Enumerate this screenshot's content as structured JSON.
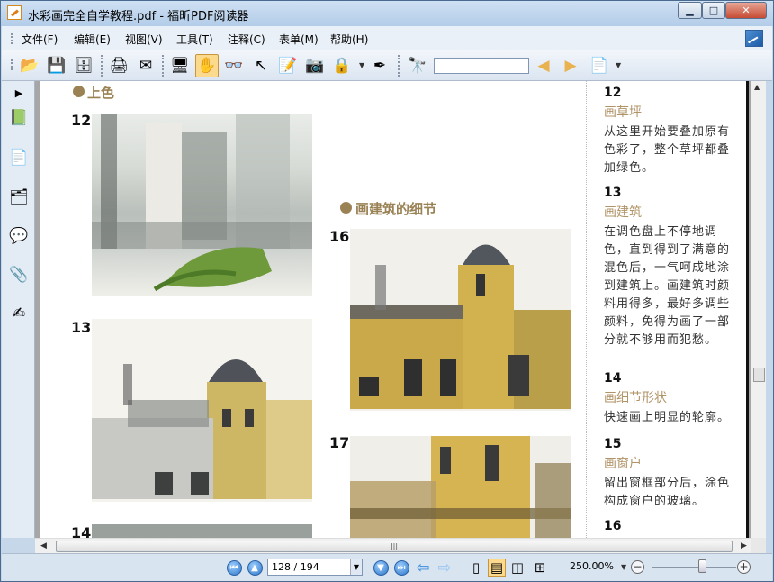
{
  "window": {
    "title": "水彩画完全自学教程.pdf - 福昕PDF阅读器",
    "min": "▁",
    "max": "□",
    "close": "✕"
  },
  "menu": [
    "文件(F)",
    "编辑(E)",
    "视图(V)",
    "工具(T)",
    "注释(C)",
    "表单(M)",
    "帮助(H)"
  ],
  "toolbar": {
    "search_value": ""
  },
  "page": {
    "section_title": "上色",
    "section2_title": "画建筑的细节",
    "nums": [
      "12",
      "13",
      "14",
      "16",
      "17"
    ],
    "steps": [
      {
        "num": "12",
        "heading": "画草坪",
        "text": "从这里开始要叠加原有色彩了，整个草坪都叠加绿色。"
      },
      {
        "num": "13",
        "heading": "画建筑",
        "text": "在调色盘上不停地调色，直到得到了满意的混色后，一气呵成地涂到建筑上。画建筑时颜料用得多，最好多调些颜料，免得为画了一部分就不够用而犯愁。"
      },
      {
        "num": "14",
        "heading": "画细节形状",
        "text": "快速画上明显的轮廓。"
      },
      {
        "num": "15",
        "heading": "画窗户",
        "text": "留出窗框部分后，涂色构成窗户的玻璃。"
      },
      {
        "num": "16",
        "heading": "",
        "text": ""
      }
    ]
  },
  "status": {
    "page_input": "128 / 194",
    "zoom": "250.00%"
  },
  "colors": {
    "accent": "#9a8255",
    "heading": "#b09366",
    "chrome": "#c7d7ea"
  }
}
